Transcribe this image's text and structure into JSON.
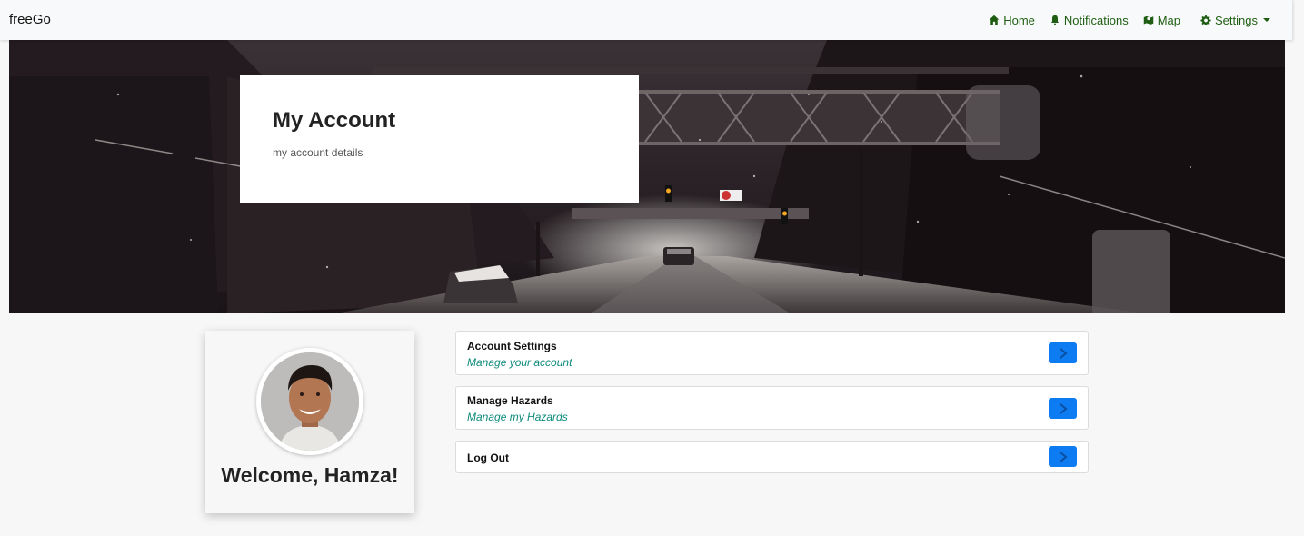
{
  "navbar": {
    "brand": "freeGo",
    "links": [
      {
        "label": "Home",
        "icon": "home-icon"
      },
      {
        "label": "Notifications",
        "icon": "bell-icon"
      },
      {
        "label": "Map",
        "icon": "map-icon"
      },
      {
        "label": "Settings",
        "icon": "gear-icon"
      }
    ]
  },
  "hero": {
    "title": "My Account",
    "subtitle": "my account details"
  },
  "profile": {
    "welcome": "Welcome, Hamza!"
  },
  "menu": [
    {
      "title": "Account Settings",
      "description": "Manage your account"
    },
    {
      "title": "Manage Hazards",
      "description": "Manage my Hazards"
    },
    {
      "title": "Log Out",
      "description": ""
    }
  ],
  "colors": {
    "nav_link": "#1f5e12",
    "button": "#0d7cf2",
    "description": "#0c8a7a"
  }
}
